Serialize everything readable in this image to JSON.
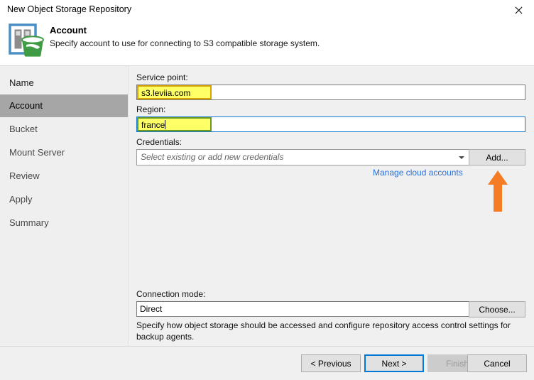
{
  "window": {
    "title": "New Object Storage Repository",
    "close_icon": "close-icon"
  },
  "header": {
    "icon": "object-storage-repository-icon",
    "title": "Account",
    "subtitle": "Specify account to use for connecting to S3 compatible storage system."
  },
  "sidebar": {
    "items": [
      {
        "label": "Name",
        "active": false
      },
      {
        "label": "Account",
        "active": true
      },
      {
        "label": "Bucket",
        "active": false
      },
      {
        "label": "Mount Server",
        "active": false
      },
      {
        "label": "Review",
        "active": false
      },
      {
        "label": "Apply",
        "active": false
      },
      {
        "label": "Summary",
        "active": false
      }
    ]
  },
  "form": {
    "service_point": {
      "label": "Service point:",
      "value": "s3.leviia.com"
    },
    "region": {
      "label": "Region:",
      "value": "france"
    },
    "credentials": {
      "label": "Credentials:",
      "placeholder": "Select existing or add new credentials",
      "add_button": "Add...",
      "manage_link": "Manage cloud accounts",
      "dropdown_icon": "chevron-down-icon"
    },
    "connection_mode": {
      "label": "Connection mode:",
      "value": "Direct",
      "choose_button": "Choose...",
      "hint": "Specify how object storage should be accessed and configure repository access control settings for backup agents."
    }
  },
  "annotation": {
    "arrow_icon": "arrow-up-icon",
    "color": "#f57c24"
  },
  "footer": {
    "previous": "< Previous",
    "next": "Next >",
    "finish": "Finish",
    "cancel": "Cancel"
  },
  "colors": {
    "highlight": "#ffff66",
    "link": "#2a6fd6",
    "focus": "#0078d7",
    "sidebar_active": "#a6a6a6"
  }
}
